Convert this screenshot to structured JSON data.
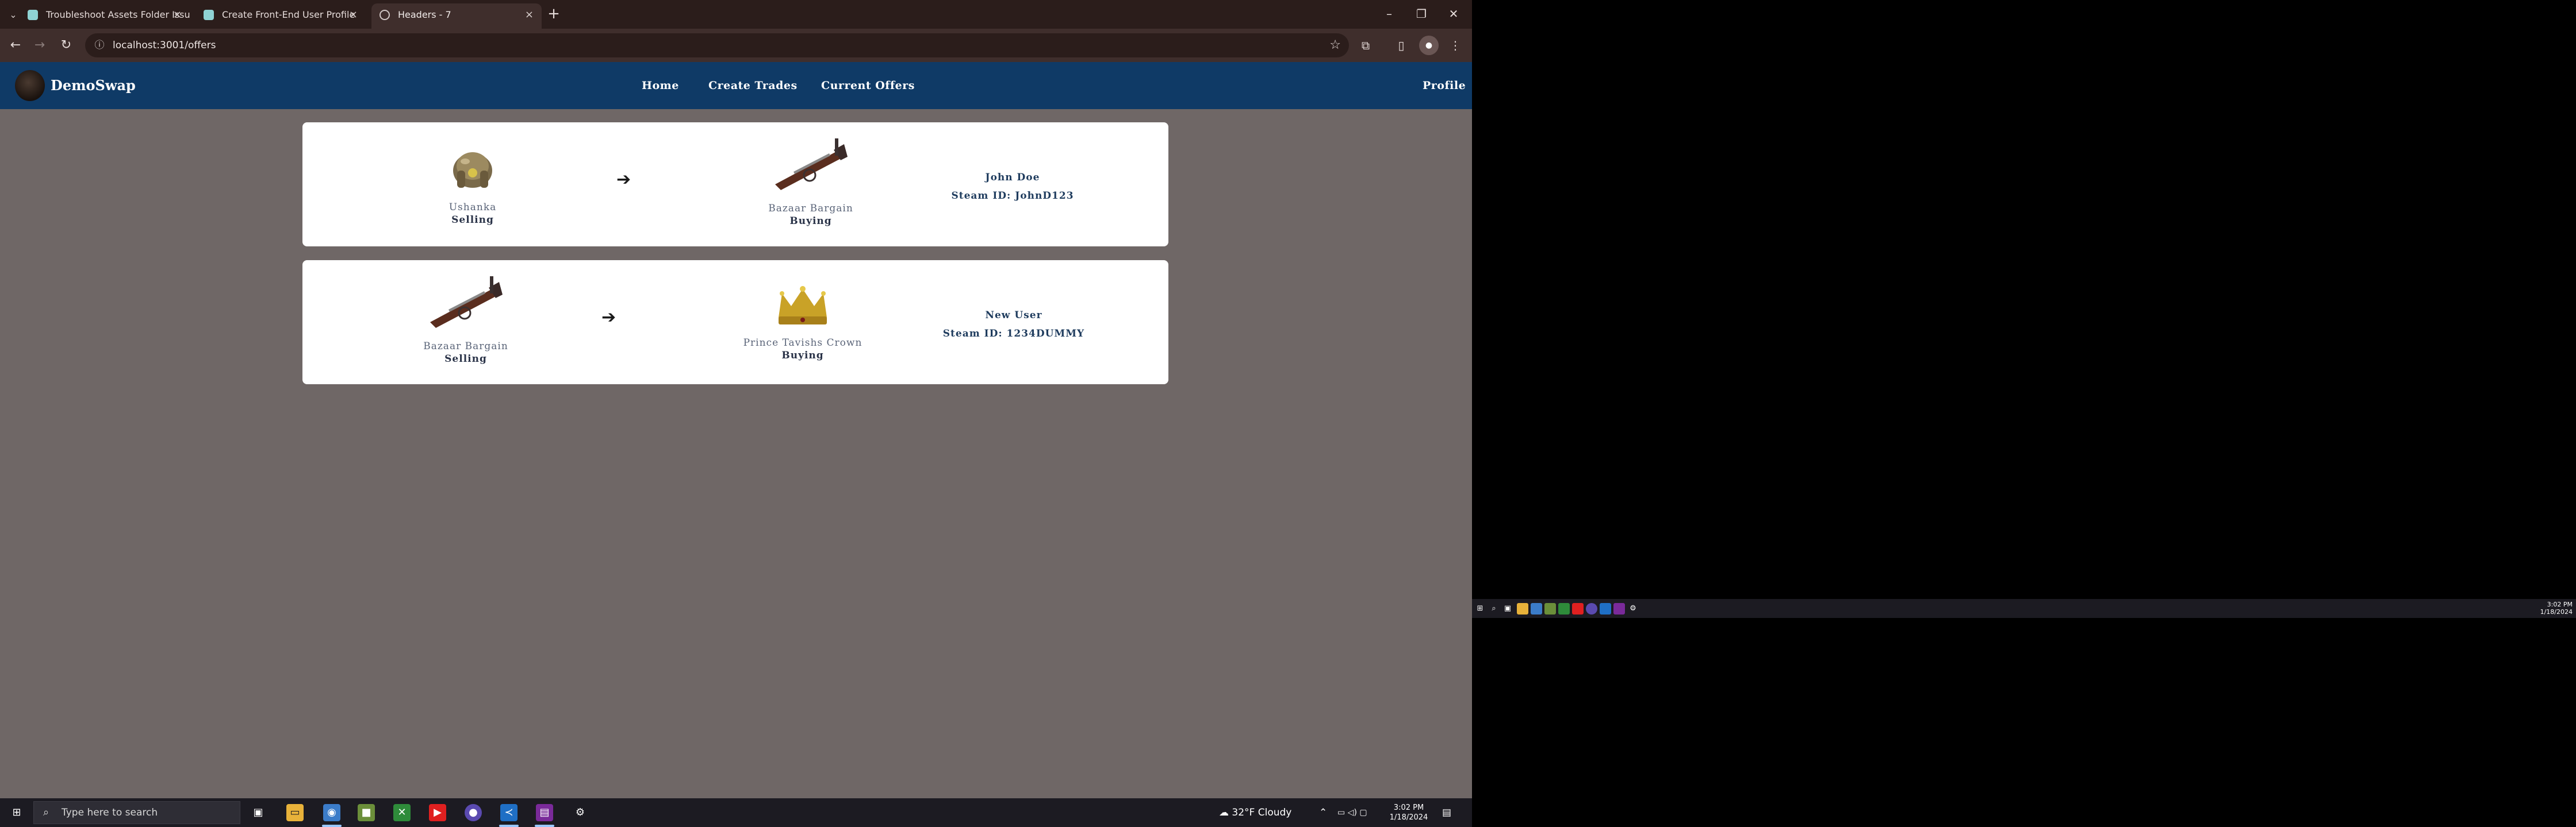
{
  "browser": {
    "tabs": [
      {
        "title": "Troubleshoot Assets Folder Issue"
      },
      {
        "title": "Create Front-End User Profile"
      },
      {
        "title": "Headers - 7"
      }
    ],
    "url": "localhost:3001/offers"
  },
  "site": {
    "brand": "DemoSwap",
    "nav": {
      "home": "Home",
      "create_trades": "Create Trades",
      "current_offers": "Current Offers",
      "profile": "Profile"
    }
  },
  "offers": [
    {
      "selling": {
        "name": "Ushanka",
        "role": "Selling",
        "icon": "ushanka-hat-icon"
      },
      "buying": {
        "name": "Bazaar Bargain",
        "role": "Buying",
        "icon": "sniper-rifle-icon"
      },
      "arrow": "➔",
      "user": {
        "name": "John Doe",
        "steam_id": "Steam ID: JohnD123"
      }
    },
    {
      "selling": {
        "name": "Bazaar Bargain",
        "role": "Selling",
        "icon": "sniper-rifle-icon"
      },
      "buying": {
        "name": "Prince Tavishs Crown",
        "role": "Buying",
        "icon": "crown-icon"
      },
      "arrow": "➔",
      "user": {
        "name": "New User",
        "steam_id": "Steam ID: 1234DUMMY"
      }
    }
  ],
  "taskbar": {
    "search_placeholder": "Type here to search",
    "weather": "32°F  Cloudy",
    "time": "3:02 PM",
    "date": "1/18/2024"
  },
  "taskbar2": {
    "time": "3:02 PM",
    "date": "1/18/2024"
  },
  "colors": {
    "nav_bg": "#0f3a66",
    "page_bg": "#6f6766",
    "card_bg": "#ffffff",
    "chrome_frame": "#2b1d1b"
  }
}
